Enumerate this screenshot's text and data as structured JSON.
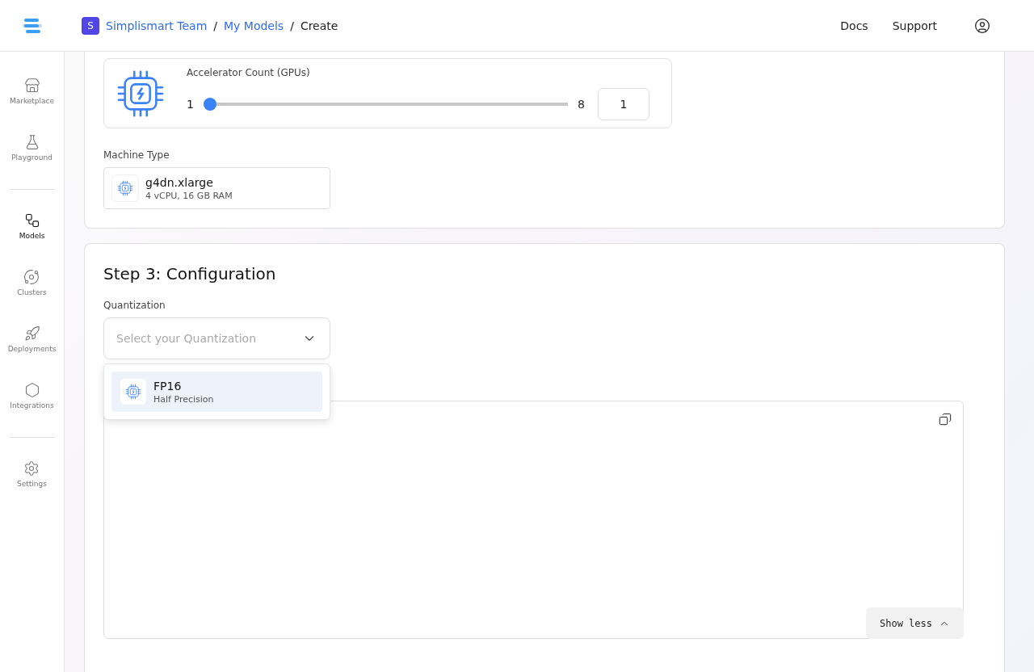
{
  "header": {
    "team_initial": "S",
    "breadcrumbs": [
      {
        "label": "Simplismart Team",
        "kind": "link"
      },
      {
        "label": "My Models",
        "kind": "link"
      },
      {
        "label": "Create",
        "kind": "current"
      }
    ],
    "separator": "/",
    "links": [
      "Docs",
      "Support"
    ]
  },
  "sidebar": {
    "groups": [
      [
        {
          "label": "Marketplace",
          "selected": false
        },
        {
          "label": "Playground",
          "selected": false
        }
      ],
      [
        {
          "label": "Models",
          "selected": true
        },
        {
          "label": "Clusters",
          "selected": false
        },
        {
          "label": "Deployments",
          "selected": false
        },
        {
          "label": "Integrations",
          "selected": false
        }
      ],
      [
        {
          "label": "Settings",
          "selected": false
        }
      ]
    ]
  },
  "accelerator": {
    "label": "Accelerator Count (GPUs)",
    "min": "1",
    "max": "8",
    "level": 0,
    "value": "1"
  },
  "machine_type": {
    "label": "Machine Type",
    "name": "g4dn.xlarge",
    "spec": "4 vCPU, 16 GB RAM"
  },
  "step3": {
    "title": "Step 3: Configuration",
    "quantization": {
      "label": "Quantization",
      "placeholder": "Select your Quantization",
      "options": [
        {
          "name": "FP16",
          "description": "Half Precision",
          "selected": true
        }
      ]
    },
    "code_button": "Show less"
  }
}
